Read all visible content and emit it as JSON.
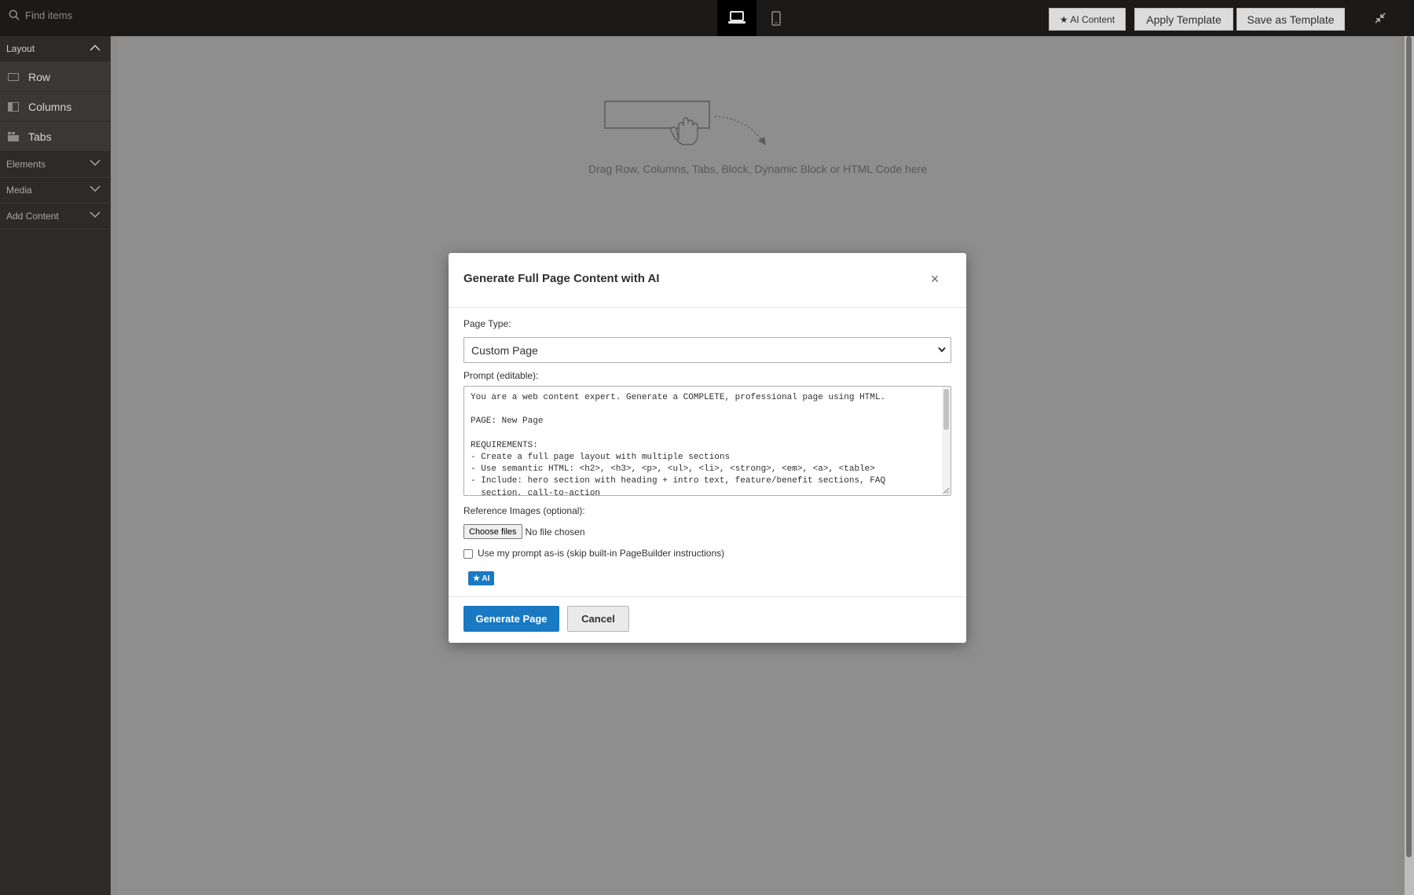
{
  "topbar": {
    "search": {
      "placeholder": "Find items",
      "value": ""
    },
    "buttons": {
      "ai_content": "★ AI Content",
      "apply_template": "Apply Template",
      "save_as_template": "Save as Template"
    },
    "devices": {
      "desktop_icon": "laptop-icon",
      "mobile_icon": "mobile-icon",
      "active": "desktop"
    }
  },
  "sidebar": {
    "sections": [
      {
        "label": "Layout",
        "expanded": true,
        "items": [
          "Row",
          "Columns",
          "Tabs"
        ]
      },
      {
        "label": "Elements",
        "expanded": false
      },
      {
        "label": "Media",
        "expanded": false
      },
      {
        "label": "Add Content",
        "expanded": false
      }
    ]
  },
  "stage": {
    "drop_text": "Drag Row, Columns, Tabs, Block, Dynamic Block or HTML Code here"
  },
  "modal": {
    "title": "Generate Full Page Content with AI",
    "close": "×",
    "page_type_label": "Page Type:",
    "page_type_value": "Custom Page",
    "prompt_label": "Prompt (editable):",
    "prompt_value": "You are a web content expert. Generate a COMPLETE, professional page using HTML.\n\nPAGE: New Page\n\nREQUIREMENTS:\n- Create a full page layout with multiple sections\n- Use semantic HTML: <h2>, <h3>, <p>, <ul>, <li>, <strong>, <em>, <a>, <table>\n- Include: hero section with heading + intro text, feature/benefit sections, FAQ\n  section, call-to-action",
    "reference_label": "Reference Images (optional):",
    "choose_files": "Choose files",
    "no_file": "No file chosen",
    "use_as_is_label": "Use my prompt as-is (skip built-in PageBuilder instructions)",
    "ai_badge": "★ AI",
    "generate_button": "Generate Page",
    "cancel_button": "Cancel"
  },
  "colors": {
    "accent": "#1979c3",
    "topbar": "#1c1a19",
    "sidebar": "#2d2b2a",
    "stage": "#8e8e8e"
  }
}
